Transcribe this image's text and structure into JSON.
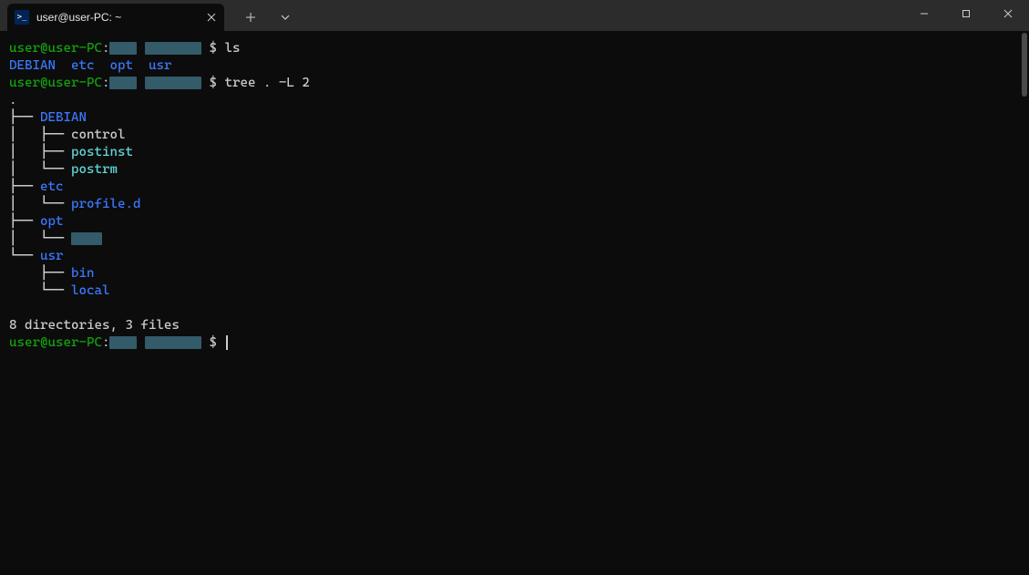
{
  "tab": {
    "title": "user@user-PC: ~"
  },
  "prompt": {
    "user_host": "user@user-PC",
    "sep": ":",
    "dollar": "$"
  },
  "cmd": {
    "ls": "ls",
    "tree": "tree . -L 2"
  },
  "ls_out": {
    "d1": "DEBIAN",
    "d2": "etc",
    "d3": "opt",
    "d4": "usr"
  },
  "tree": {
    "dot": ".",
    "p_mid": "├── ",
    "p_end": "└── ",
    "pipe": "│   ",
    "space": "    ",
    "DEBIAN": "DEBIAN",
    "control": "control",
    "postinst": "postinst",
    "postrm": "postrm",
    "etc": "etc",
    "profiled": "profile.d",
    "opt": "opt",
    "usr": "usr",
    "bin": "bin",
    "local": "local"
  },
  "summary": "8 directories, 3 files"
}
